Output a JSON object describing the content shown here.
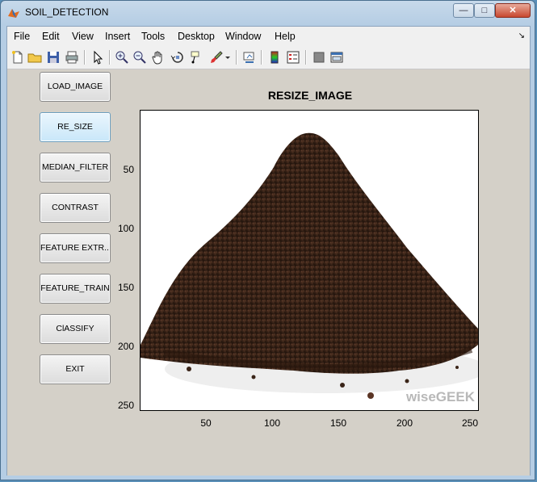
{
  "window": {
    "title": "SOIL_DETECTION"
  },
  "menu": [
    "File",
    "Edit",
    "View",
    "Insert",
    "Tools",
    "Desktop",
    "Window",
    "Help"
  ],
  "toolbar_icons": [
    "new-file-icon",
    "open-folder-icon",
    "save-icon",
    "print-icon",
    "pointer-icon",
    "zoom-in-icon",
    "zoom-out-icon",
    "pan-hand-icon",
    "rotate-3d-icon",
    "data-cursor-icon",
    "brush-icon",
    "brush-dropdown-icon",
    "link-plot-icon",
    "colorbar-icon",
    "legend-icon",
    "hide-plot-tools-icon",
    "show-plot-tools-icon"
  ],
  "buttons": {
    "load_image": "LOAD_IMAGE",
    "re_size": "RE_SIZE",
    "median_filter": "MEDIAN_FILTER",
    "contrast": "CONTRAST",
    "feature_extr": "FEATURE EXTR...",
    "feature_train": "FEATURE_TRAIN",
    "classify": "ClASSIFY",
    "exit": "EXIT"
  },
  "axes": {
    "title": "RESIZE_IMAGE",
    "x_ticks": [
      "50",
      "100",
      "150",
      "200",
      "250"
    ],
    "y_ticks": [
      "50",
      "100",
      "150",
      "200",
      "250"
    ],
    "watermark": "wiseGEEK"
  },
  "colors": {
    "figure_bg": "#d4d0c8",
    "soil": "#3a2418"
  }
}
